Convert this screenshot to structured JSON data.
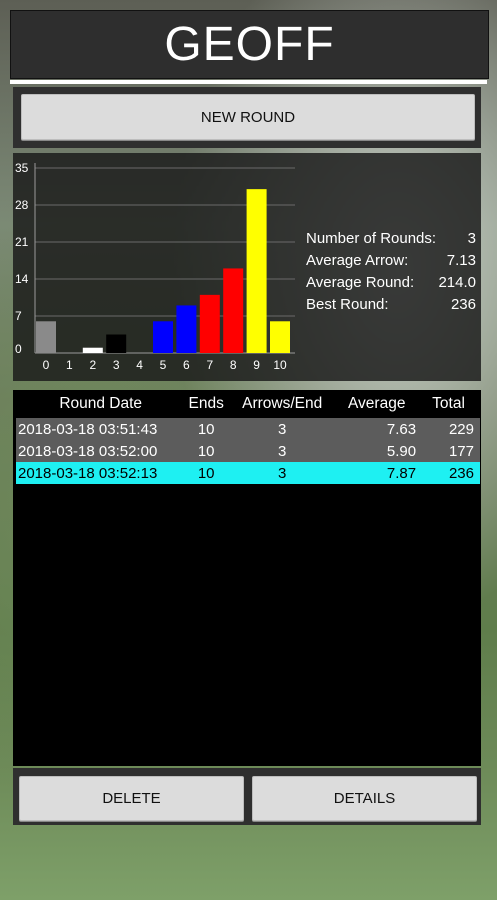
{
  "header": {
    "title": "GEOFF"
  },
  "actions": {
    "new_round_label": "NEW ROUND",
    "delete_label": "DELETE",
    "details_label": "DETAILS"
  },
  "chart_data": {
    "type": "bar",
    "categories": [
      "0",
      "1",
      "2",
      "3",
      "4",
      "5",
      "6",
      "7",
      "8",
      "9",
      "10"
    ],
    "values": [
      6,
      0,
      1,
      3.5,
      0,
      6,
      9,
      11,
      16,
      31,
      6
    ],
    "colors": [
      "#8a8a8a",
      "#8a8a8a",
      "#ffffff",
      "#000000",
      "#000000",
      "#0000ff",
      "#0000ff",
      "#ff0000",
      "#ff0000",
      "#ffff00",
      "#ffff00"
    ],
    "y_ticks": [
      "0",
      "7",
      "14",
      "21",
      "28",
      "35"
    ],
    "ylim": [
      0,
      35
    ],
    "grid": true
  },
  "stats": [
    {
      "label": "Number of Rounds:",
      "value": "3"
    },
    {
      "label": "Average Arrow:",
      "value": "7.13"
    },
    {
      "label": "Average Round:",
      "value": "214.0"
    },
    {
      "label": "Best Round:",
      "value": "236"
    }
  ],
  "table": {
    "headers": [
      "Round Date",
      "Ends",
      "Arrows/End",
      "Average",
      "Total"
    ],
    "rows": [
      [
        "2018-03-18 03:51:43",
        "10",
        "3",
        "7.63",
        "229"
      ],
      [
        "2018-03-18 03:52:00",
        "10",
        "3",
        "5.90",
        "177"
      ],
      [
        "2018-03-18 03:52:13",
        "10",
        "3",
        "7.87",
        "236"
      ]
    ]
  }
}
